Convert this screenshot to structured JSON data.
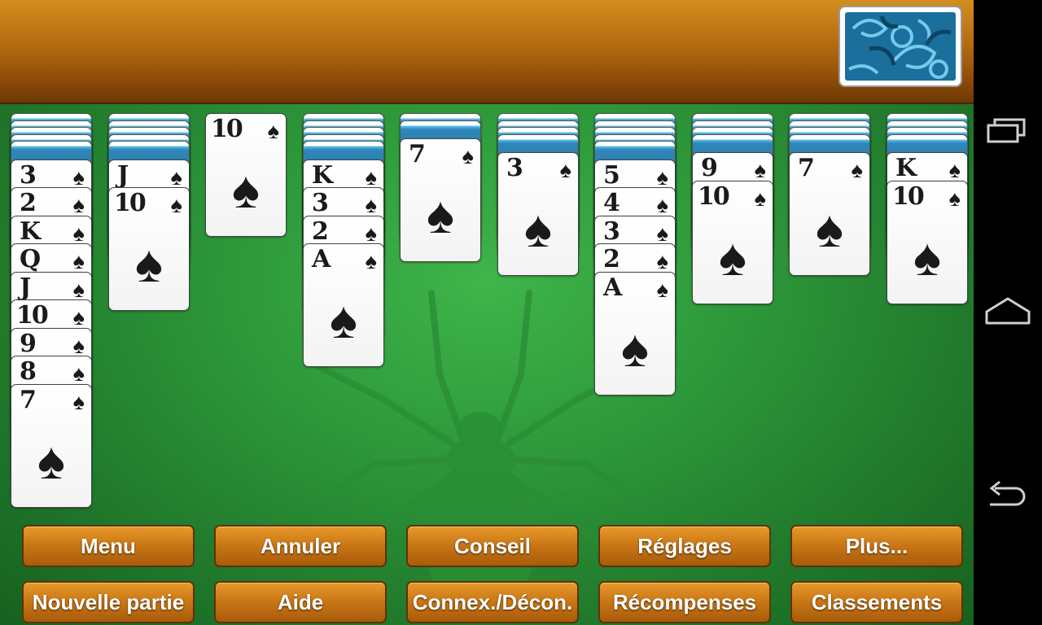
{
  "header": {
    "stock_label": "stock-pile"
  },
  "tableau": [
    {
      "hidden": 5,
      "cards": [
        "3",
        "2",
        "K",
        "Q",
        "J",
        "10",
        "9",
        "8",
        "7"
      ]
    },
    {
      "hidden": 5,
      "cards": [
        "J",
        "10"
      ]
    },
    {
      "hidden": 0,
      "cards": [
        "10"
      ]
    },
    {
      "hidden": 5,
      "cards": [
        "K",
        "3",
        "2",
        "A"
      ]
    },
    {
      "hidden": 2,
      "cards": [
        "7"
      ]
    },
    {
      "hidden": 4,
      "cards": [
        "3"
      ]
    },
    {
      "hidden": 5,
      "cards": [
        "5",
        "4",
        "3",
        "2",
        "A"
      ]
    },
    {
      "hidden": 4,
      "cards": [
        "9",
        "10"
      ]
    },
    {
      "hidden": 4,
      "cards": [
        "7"
      ]
    },
    {
      "hidden": 4,
      "cards": [
        "K",
        "10"
      ]
    }
  ],
  "suit_symbol": "♠",
  "buttons": {
    "row1": [
      "Menu",
      "Annuler",
      "Conseil",
      "Réglages",
      "Plus..."
    ],
    "row2": [
      "Nouvelle partie",
      "Aide",
      "Connex./Décon.",
      "Récompenses",
      "Classements"
    ]
  },
  "navbar": {
    "icons": [
      "recent-apps-icon",
      "home-icon",
      "back-icon"
    ]
  },
  "colors": {
    "felt": "#2e9a3b",
    "bar": "#b36a10",
    "card_back": "#2f86b8"
  }
}
